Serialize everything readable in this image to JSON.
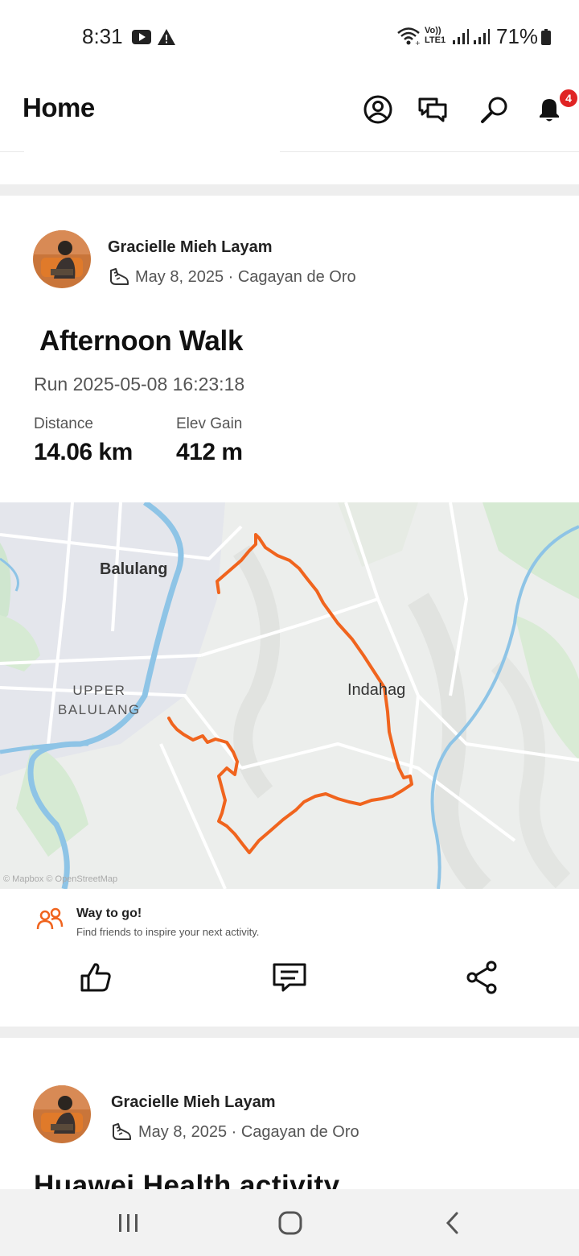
{
  "status_bar": {
    "time": "8:31",
    "volte_line1": "Vo))",
    "volte_line2": "LTE1",
    "battery": "71%"
  },
  "header": {
    "title": "Home",
    "notification_count": "4",
    "icons": [
      "profile-icon",
      "chat-icon",
      "search-icon",
      "bell-icon"
    ]
  },
  "feed": [
    {
      "athlete": "Gracielle Mieh Layam",
      "meta": "May 8, 2025 · Cagayan de Oro",
      "title": "Afternoon Walk",
      "subtitle": "Run 2025-05-08 16:23:18",
      "stats": [
        {
          "label": "Distance",
          "value": "14.06 km"
        },
        {
          "label": "Elev Gain",
          "value": "412 m"
        }
      ],
      "map": {
        "labels": [
          "Balulang",
          "Indahag"
        ],
        "upper_line1": "UPPER",
        "upper_line2": "BALULANG",
        "attribution": "© Mapbox  © OpenStreetMap",
        "route_color": "#f0641e"
      },
      "prompt": {
        "title": "Way to go!",
        "subtitle": "Find friends to inspire your next activity."
      },
      "actions": [
        "like-icon",
        "comment-icon",
        "share-icon"
      ]
    },
    {
      "athlete": "Gracielle Mieh Layam",
      "meta": "May 8, 2025 · Cagayan de Oro",
      "title": "Huawei Health activity"
    }
  ],
  "colors": {
    "accent": "#fc5200",
    "badge": "#e02424",
    "route": "#f0641e"
  }
}
